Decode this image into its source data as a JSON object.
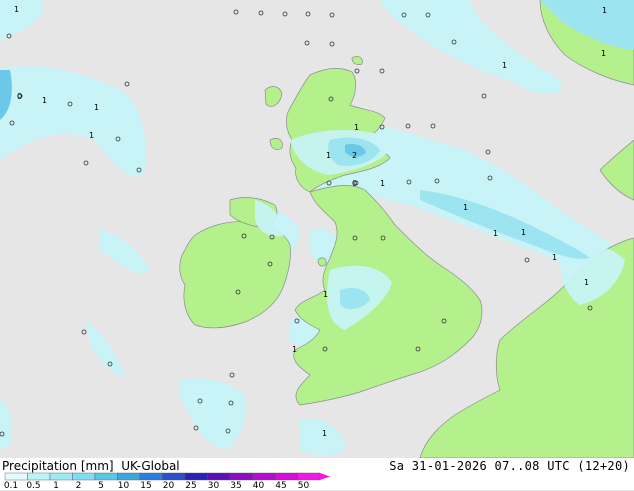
{
  "header": {
    "product": "Precipitation [mm]",
    "model": "UK-Global",
    "valid": "Sa 31-01-2026 07..08 UTC (12+20)"
  },
  "legend": {
    "ticks": [
      "0.1",
      "0.5",
      "1",
      "2",
      "5",
      "10",
      "15",
      "20",
      "25",
      "30",
      "35",
      "40",
      "45",
      "50"
    ],
    "colors": [
      "#e0fcfc",
      "#b8f4f8",
      "#9ce8f4",
      "#80dcf0",
      "#56c8e8",
      "#3aa8dc",
      "#2a7ee0",
      "#2c4fd0",
      "#2a22b8",
      "#5a10b8",
      "#8a0cc4",
      "#b80cd0",
      "#d80cd8",
      "#f418e4"
    ]
  },
  "map": {
    "colors": {
      "sea": "#e6e6e6",
      "land": "#b4f08c",
      "coast": "#8c8c8c",
      "rain_light": "#c8f4f8",
      "rain_mid": "#9ce4f0",
      "rain_heavy": "#6cc8e8"
    },
    "labels": [
      "1",
      "1",
      "0",
      "1",
      "1",
      "1",
      "1",
      "1",
      "2",
      "1",
      "0",
      "1",
      "1",
      "1",
      "1",
      "1",
      "1",
      "1",
      "1",
      "1",
      "0"
    ]
  }
}
